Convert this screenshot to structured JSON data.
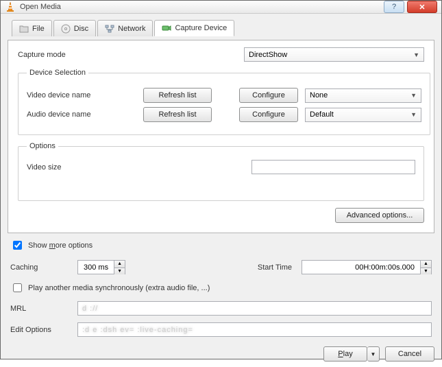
{
  "titlebar": {
    "title": "Open Media"
  },
  "tabs": {
    "file": "File",
    "disc": "Disc",
    "network": "Network",
    "capture": "Capture Device"
  },
  "capture": {
    "mode_label": "Capture mode",
    "mode_value": "DirectShow",
    "device_section": "Device Selection",
    "video_label": "Video device name",
    "audio_label": "Audio device name",
    "refresh": "Refresh list",
    "configure": "Configure",
    "video_value": "None",
    "audio_value": "Default",
    "options_section": "Options",
    "video_size_label": "Video size",
    "video_size_value": "",
    "advanced": "Advanced options..."
  },
  "more": {
    "show_label": "Show more options",
    "caching_label": "Caching",
    "caching_value": "300 ms",
    "start_label": "Start Time",
    "start_value": "00H:00m:00s.000",
    "sync_label": "Play another media synchronously (extra audio file, ...)",
    "mrl_label": "MRL",
    "mrl_value": "d        ://",
    "edit_label": "Edit Options",
    "edit_value": ":d                   e :dsh        ev=  :live-caching="
  },
  "footer": {
    "play": "Play",
    "cancel": "Cancel"
  }
}
